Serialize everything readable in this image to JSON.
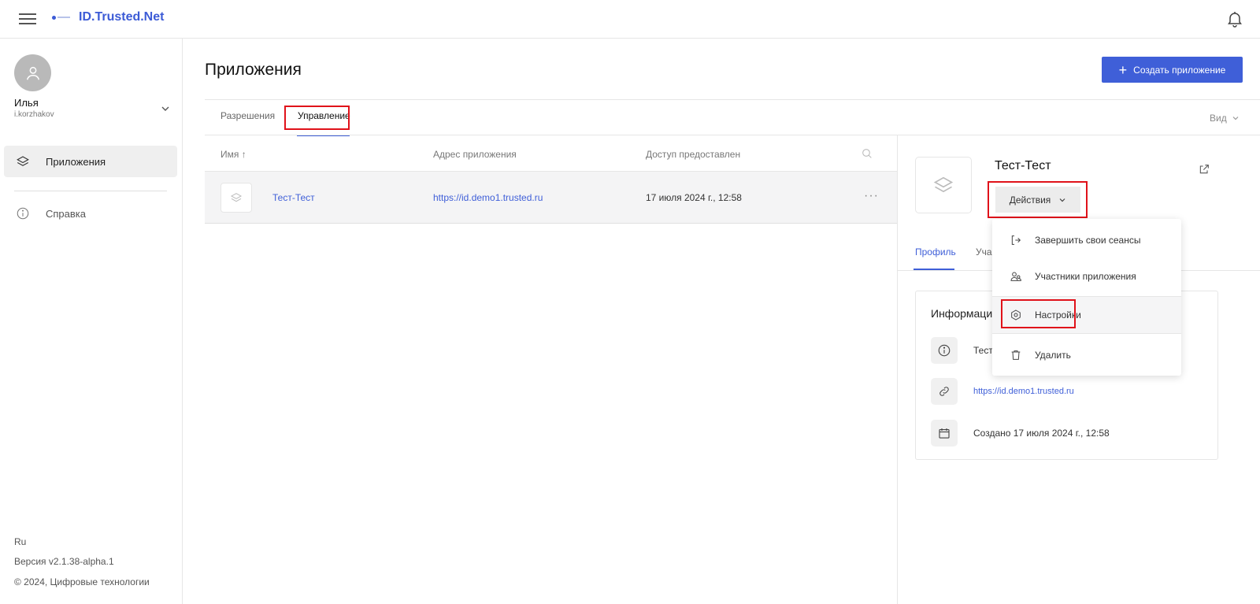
{
  "header": {
    "brand": "ID.Trusted.Net"
  },
  "user": {
    "name": "Илья",
    "login": "i.korzhakov"
  },
  "sidebar": {
    "items": [
      {
        "label": "Приложения"
      },
      {
        "label": "Справка"
      }
    ],
    "footer": {
      "lang": "Ru",
      "version": "Версия v2.1.38-alpha.1",
      "copyright": "© 2024, Цифровые технологии"
    }
  },
  "page": {
    "title": "Приложения",
    "create_label": "Создать приложение",
    "tabs": [
      {
        "label": "Разрешения"
      },
      {
        "label": "Управление"
      }
    ],
    "view_label": "Вид"
  },
  "table": {
    "columns": [
      "Имя ↑",
      "Адрес приложения",
      "Доступ предоставлен"
    ],
    "rows": [
      {
        "name": "Тест-Тест",
        "url": "https://id.demo1.trusted.ru",
        "granted": "17 июля 2024 г., 12:58"
      }
    ]
  },
  "detail": {
    "title": "Тест-Тест",
    "actions_label": "Действия",
    "tabs": [
      {
        "label": "Профиль"
      },
      {
        "label": "Учас"
      }
    ],
    "info_title": "Информаци",
    "info_rows": [
      {
        "text": "Тест"
      },
      {
        "text": "https://id.demo1.trusted.ru"
      },
      {
        "text": "Создано 17 июля 2024 г., 12:58"
      }
    ]
  },
  "actions_menu": {
    "items": [
      {
        "label": "Завершить свои сеансы"
      },
      {
        "label": "Участники приложения"
      },
      {
        "label": "Настройки"
      },
      {
        "label": "Удалить"
      }
    ]
  },
  "colors": {
    "accent": "#3f5fd8",
    "highlight": "#e0121a"
  }
}
